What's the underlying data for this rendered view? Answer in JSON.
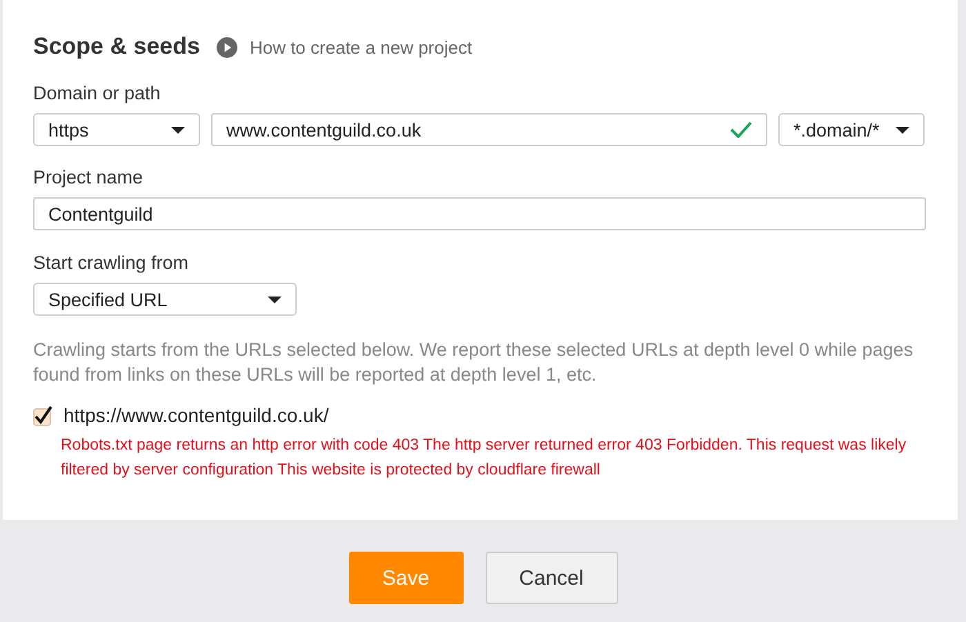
{
  "section": {
    "title": "Scope & seeds",
    "help_link": "How to create a new project"
  },
  "domain": {
    "label": "Domain or path",
    "protocol": "https",
    "value": "www.contentguild.co.uk",
    "valid": true,
    "scope": "*.domain/*"
  },
  "project_name": {
    "label": "Project name",
    "value": "Contentguild"
  },
  "start_crawling": {
    "label": "Start crawling from",
    "value": "Specified URL"
  },
  "description": "Crawling starts from the URLs selected below. We report these selected URLs at depth level 0 while pages found from links on these URLs will be reported at depth level 1, etc.",
  "seeds": [
    {
      "url": "https://www.contentguild.co.uk/",
      "checked": true,
      "error": "Robots.txt page returns an http error with code 403 The http server returned error 403 Forbidden. This request was likely filtered by server configuration This website is protected by cloudflare firewall"
    }
  ],
  "buttons": [
    {
      "label": "Save",
      "kind": "primary"
    },
    {
      "label": "Cancel",
      "kind": "secondary"
    }
  ]
}
